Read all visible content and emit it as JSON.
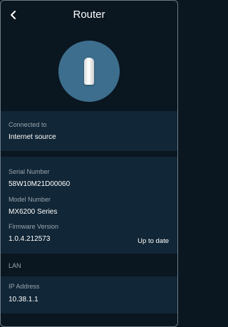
{
  "header": {
    "back_icon": "chevron-left-icon",
    "title": "Router"
  },
  "device_image": {
    "icon": "router-device-icon",
    "circle_color": "#3d6e8d"
  },
  "connection": {
    "label": "Connected to",
    "value": "Internet source"
  },
  "details": {
    "serial_label": "Serial Number",
    "serial_value": "58W10M21D00060",
    "model_label": "Model Number",
    "model_value": "MX6200 Series",
    "firmware_label": "Firmware Version",
    "firmware_value": "1.0.4.212573",
    "firmware_status": "Up to date"
  },
  "lan": {
    "section_label": "LAN",
    "ip_label": "IP Address",
    "ip_value": "10.38.1.1"
  },
  "colors": {
    "background": "#0a1620",
    "panel": "#112636",
    "label_text": "#9aa6b0"
  }
}
